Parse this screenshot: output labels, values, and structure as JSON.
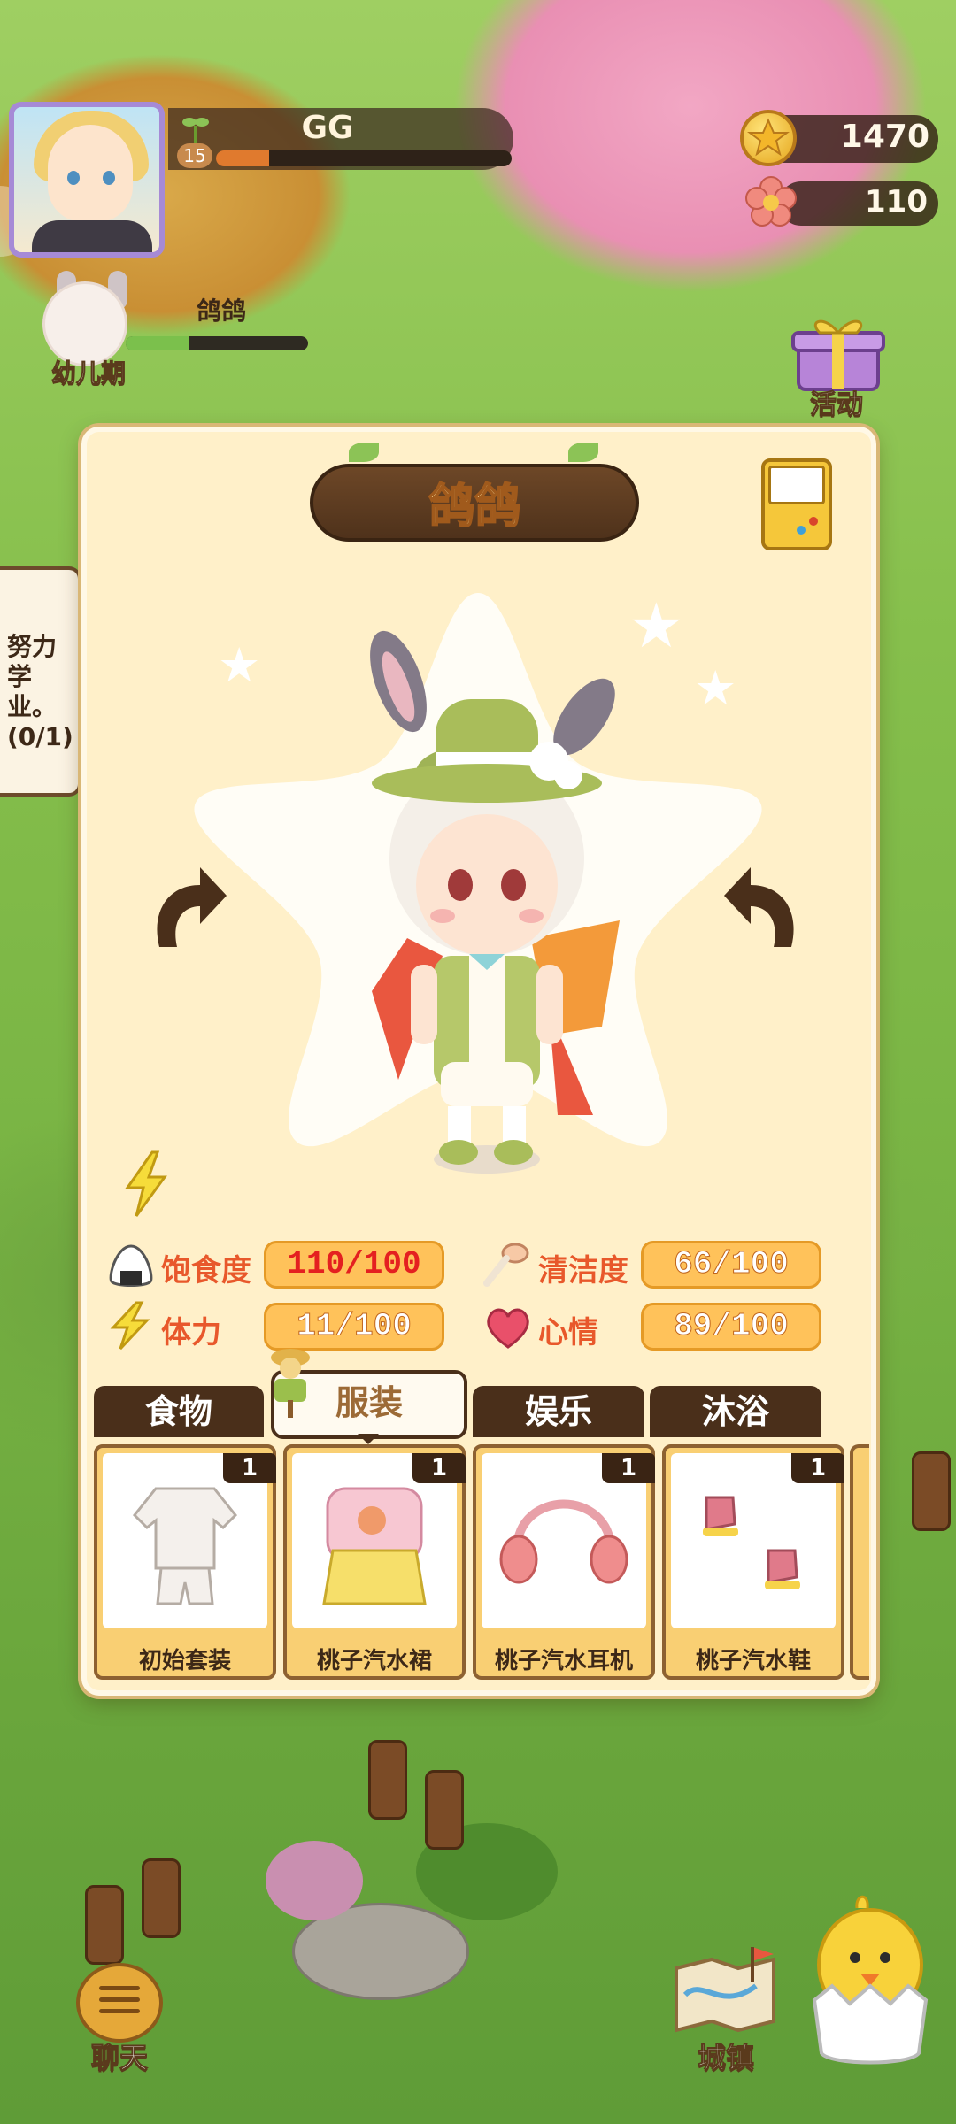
{
  "player": {
    "name": "GG",
    "level": "15",
    "xp_fraction": 0.18
  },
  "currency": {
    "coins": "1470",
    "flowers": "110"
  },
  "pet": {
    "stage": "幼儿期",
    "name": "鸽鸽",
    "growth_fraction": 0.35
  },
  "activity": {
    "label": "活动"
  },
  "task": {
    "text": "努力学\n业。\n(0/1)"
  },
  "panel": {
    "title": "鸽鸽",
    "stats": [
      {
        "id": "satiety",
        "label": "饱食度",
        "value": "110/100",
        "warn": true,
        "icon": "rice-ball-icon"
      },
      {
        "id": "cleanliness",
        "label": "清洁度",
        "value": "66/100",
        "warn": false,
        "icon": "brush-icon"
      },
      {
        "id": "stamina",
        "label": "体力",
        "value": "11/100",
        "warn": false,
        "icon": "lightning-icon"
      },
      {
        "id": "mood",
        "label": "心情",
        "value": "89/100",
        "warn": false,
        "icon": "heart-icon"
      }
    ],
    "tabs": [
      "食物",
      "服装",
      "娱乐",
      "沐浴"
    ],
    "active_tab": 1,
    "items": [
      {
        "name": "初始套装",
        "count": "1",
        "icon": "starter-outfit-icon"
      },
      {
        "name": "桃子汽水裙",
        "count": "1",
        "icon": "peach-soda-dress-icon"
      },
      {
        "name": "桃子汽水耳机",
        "count": "1",
        "icon": "peach-soda-headphones-icon"
      },
      {
        "name": "桃子汽水鞋",
        "count": "1",
        "icon": "peach-soda-shoes-icon"
      }
    ]
  },
  "bottom": {
    "chat_label": "聊天",
    "town_label": "城镇"
  },
  "colors": {
    "panel_bg": "#fff0c9",
    "tab_dark": "#4a2f1a",
    "stat_pill": "#ffc25a",
    "warn_text": "#e42020"
  }
}
